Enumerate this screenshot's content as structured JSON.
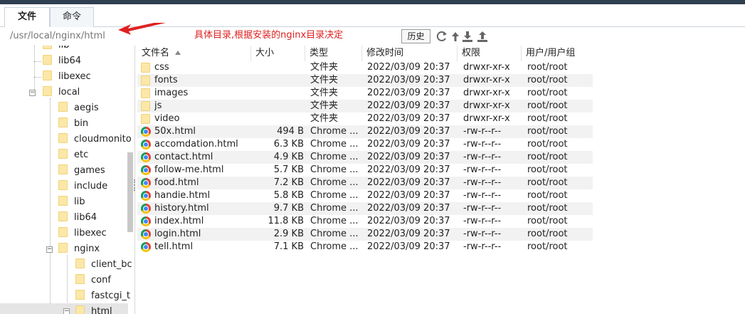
{
  "tabs": [
    "文件",
    "命令"
  ],
  "path": {
    "value": "/usr/local/nginx/html",
    "annotation": "具体目录,根据安装的nginx目录决定",
    "history_label": "历史"
  },
  "toolbar_icons": [
    "refresh-icon",
    "up-icon",
    "download-icon",
    "upload-icon"
  ],
  "tree": {
    "items": [
      {
        "label": "lib",
        "level": 1
      },
      {
        "label": "lib64",
        "level": 1
      },
      {
        "label": "libexec",
        "level": 1
      },
      {
        "label": "local",
        "level": 1
      },
      {
        "label": "aegis",
        "level": 2
      },
      {
        "label": "bin",
        "level": 2
      },
      {
        "label": "cloudmonito",
        "level": 2
      },
      {
        "label": "etc",
        "level": 2
      },
      {
        "label": "games",
        "level": 2
      },
      {
        "label": "include",
        "level": 2
      },
      {
        "label": "lib",
        "level": 2
      },
      {
        "label": "lib64",
        "level": 2
      },
      {
        "label": "libexec",
        "level": 2
      },
      {
        "label": "nginx",
        "level": 2
      },
      {
        "label": "client_bc",
        "level": 3
      },
      {
        "label": "conf",
        "level": 3
      },
      {
        "label": "fastcgi_t",
        "level": 3
      },
      {
        "label": "html",
        "level": 3
      }
    ]
  },
  "columns": [
    "文件名",
    "大小",
    "类型",
    "修改时间",
    "权限",
    "用户/用户组"
  ],
  "files": [
    {
      "name": "css",
      "size": "",
      "type": "文件夹",
      "mtime": "2022/03/09 20:37",
      "perm": "drwxr-xr-x",
      "owner": "root/root",
      "icon": "folder-icon"
    },
    {
      "name": "fonts",
      "size": "",
      "type": "文件夹",
      "mtime": "2022/03/09 20:37",
      "perm": "drwxr-xr-x",
      "owner": "root/root",
      "icon": "folder-icon"
    },
    {
      "name": "images",
      "size": "",
      "type": "文件夹",
      "mtime": "2022/03/09 20:37",
      "perm": "drwxr-xr-x",
      "owner": "root/root",
      "icon": "folder-icon"
    },
    {
      "name": "js",
      "size": "",
      "type": "文件夹",
      "mtime": "2022/03/09 20:37",
      "perm": "drwxr-xr-x",
      "owner": "root/root",
      "icon": "folder-icon"
    },
    {
      "name": "video",
      "size": "",
      "type": "文件夹",
      "mtime": "2022/03/09 20:37",
      "perm": "drwxr-xr-x",
      "owner": "root/root",
      "icon": "folder-icon"
    },
    {
      "name": "50x.html",
      "size": "494 B",
      "type": "Chrome ...",
      "mtime": "2022/03/09 20:37",
      "perm": "-rw-r--r--",
      "owner": "root/root",
      "icon": "chrome-icon"
    },
    {
      "name": "accomdation.html",
      "size": "6.3 KB",
      "type": "Chrome ...",
      "mtime": "2022/03/09 20:37",
      "perm": "-rw-r--r--",
      "owner": "root/root",
      "icon": "chrome-icon"
    },
    {
      "name": "contact.html",
      "size": "4.9 KB",
      "type": "Chrome ...",
      "mtime": "2022/03/09 20:37",
      "perm": "-rw-r--r--",
      "owner": "root/root",
      "icon": "chrome-icon"
    },
    {
      "name": "follow-me.html",
      "size": "5.7 KB",
      "type": "Chrome ...",
      "mtime": "2022/03/09 20:37",
      "perm": "-rw-r--r--",
      "owner": "root/root",
      "icon": "chrome-icon"
    },
    {
      "name": "food.html",
      "size": "7.2 KB",
      "type": "Chrome ...",
      "mtime": "2022/03/09 20:37",
      "perm": "-rw-r--r--",
      "owner": "root/root",
      "icon": "chrome-icon"
    },
    {
      "name": "handie.html",
      "size": "5.8 KB",
      "type": "Chrome ...",
      "mtime": "2022/03/09 20:37",
      "perm": "-rw-r--r--",
      "owner": "root/root",
      "icon": "chrome-icon"
    },
    {
      "name": "history.html",
      "size": "9.7 KB",
      "type": "Chrome ...",
      "mtime": "2022/03/09 20:37",
      "perm": "-rw-r--r--",
      "owner": "root/root",
      "icon": "chrome-icon"
    },
    {
      "name": "index.html",
      "size": "11.8 KB",
      "type": "Chrome ...",
      "mtime": "2022/03/09 20:37",
      "perm": "-rw-r--r--",
      "owner": "root/root",
      "icon": "chrome-icon"
    },
    {
      "name": "login.html",
      "size": "2.9 KB",
      "type": "Chrome ...",
      "mtime": "2022/03/09 20:37",
      "perm": "-rw-r--r--",
      "owner": "root/root",
      "icon": "chrome-icon"
    },
    {
      "name": "tell.html",
      "size": "7.1 KB",
      "type": "Chrome ...",
      "mtime": "2022/03/09 20:37",
      "perm": "-rw-r--r--",
      "owner": "root/root",
      "icon": "chrome-icon"
    }
  ],
  "colors": {
    "annotation": "#e02020",
    "folder": "#fbe7a8",
    "row_alt": "#f2f2f2",
    "top_bar": "#2f3f52"
  }
}
